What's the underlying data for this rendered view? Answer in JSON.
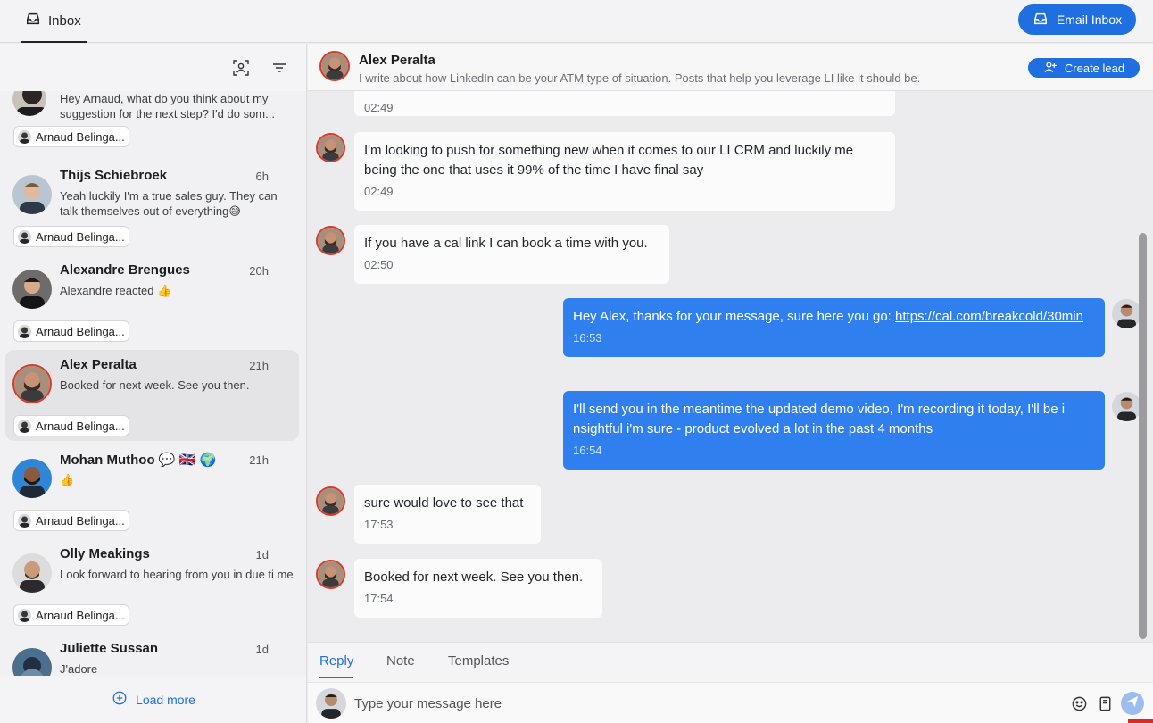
{
  "topbar": {
    "tab_label": "Inbox",
    "email_inbox_label": "Email Inbox",
    "icons": [
      "inbox-tray-icon",
      "mail-tray-icon"
    ]
  },
  "sidebar": {
    "tool_icons": [
      "contact-filter-icon",
      "filter-lines-icon"
    ],
    "conversations": [
      {
        "name": "",
        "time": "",
        "preview": "Hey Arnaud, what do you think about my suggestion for the next step? I'd do som...",
        "owner": "Arnaud Belinga...",
        "active": false
      },
      {
        "name": "Thijs Schiebroek",
        "time": "6h",
        "preview": "Yeah luckily I'm a true sales guy. They can talk themselves out of everything😅",
        "owner": "Arnaud Belinga...",
        "active": false
      },
      {
        "name": "Alexandre Brengues",
        "time": "20h",
        "preview": "Alexandre reacted 👍",
        "owner": "Arnaud Belinga...",
        "active": false
      },
      {
        "name": "Alex Peralta",
        "time": "21h",
        "preview": "Booked for next week. See you then.",
        "owner": "Arnaud Belinga...",
        "active": true
      },
      {
        "name": "Mohan Muthoo 💬 🇬🇧 🌍",
        "time": "21h",
        "preview": "👍",
        "owner": "Arnaud Belinga...",
        "active": false
      },
      {
        "name": "Olly Meakings",
        "time": "1d",
        "preview": "Look forward to hearing from you in due ti me",
        "owner": "Arnaud Belinga...",
        "active": false
      },
      {
        "name": "Juliette Sussan",
        "time": "1d",
        "preview": "J'adore",
        "owner": "",
        "active": false
      }
    ],
    "load_more_label": "Load more"
  },
  "chat": {
    "contact_name": "Alex Peralta",
    "contact_headline": "I write about how LinkedIn can be your ATM type of situation. Posts that help you leverage LI like it should be.",
    "create_lead_label": "Create lead",
    "messages": [
      {
        "direction": "in",
        "text": "",
        "time": "02:49"
      },
      {
        "direction": "in",
        "text": "I'm looking to push for something new when it comes to our LI CRM and luckily me being the one that uses it 99% of the time I have final say",
        "time": "02:49"
      },
      {
        "direction": "in",
        "text": "If you have a cal link I can book a time with you.",
        "time": "02:50"
      },
      {
        "direction": "out",
        "text": "Hey Alex, thanks for your message, sure here you go: ",
        "link": "https://cal.com/breakcold/30min",
        "time": "16:53"
      },
      {
        "direction": "out",
        "text": "I'll send you in the meantime the updated demo video, I'm recording it today, I'll be i nsightful i'm sure - product evolved a lot in the past 4 months",
        "time": "16:54"
      },
      {
        "direction": "in",
        "text": "sure would love to see that",
        "time": "17:53"
      },
      {
        "direction": "in",
        "text": "Booked for next week. See you then.",
        "time": "17:54"
      }
    ]
  },
  "composer": {
    "tabs": [
      "Reply",
      "Note",
      "Templates"
    ],
    "active_tab": "Reply",
    "placeholder": "Type your message here",
    "icons": [
      "emoji-icon",
      "template-file-icon",
      "send-icon"
    ]
  },
  "colors": {
    "accent": "#1f6fe0",
    "outgoing_bubble": "#2f7fef",
    "incoming_bubble": "#fbfbfc",
    "presence_ring": "#d93b2b"
  }
}
